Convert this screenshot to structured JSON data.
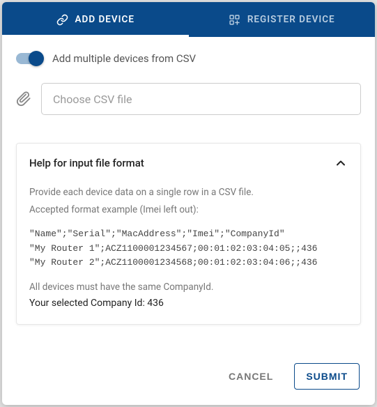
{
  "colors": {
    "primary": "#0a4a8a"
  },
  "tabs": {
    "add": {
      "label": "ADD DEVICE",
      "active": true
    },
    "register": {
      "label": "REGISTER DEVICE",
      "active": false
    }
  },
  "toggle": {
    "label": "Add multiple devices from CSV",
    "on": true
  },
  "file": {
    "placeholder": "Choose CSV file"
  },
  "help": {
    "title": "Help for input file format",
    "expanded": true,
    "line1": "Provide each device data on a single row in a CSV file.",
    "line2": "Accepted format example (Imei left out):",
    "code": "\"Name\";\"Serial\";\"MacAddress\";\"Imei\";\"CompanyId\"\n\"My Router 1\";ACZ1100001234567;00:01:02:03:04:05;;436\n\"My Router 2\";ACZ1100001234568;00:01:02:03:04:06;;436",
    "foot1": "All devices must have the same CompanyId.",
    "foot2": "Your selected Company Id: 436"
  },
  "actions": {
    "cancel": "CANCEL",
    "submit": "SUBMIT"
  }
}
